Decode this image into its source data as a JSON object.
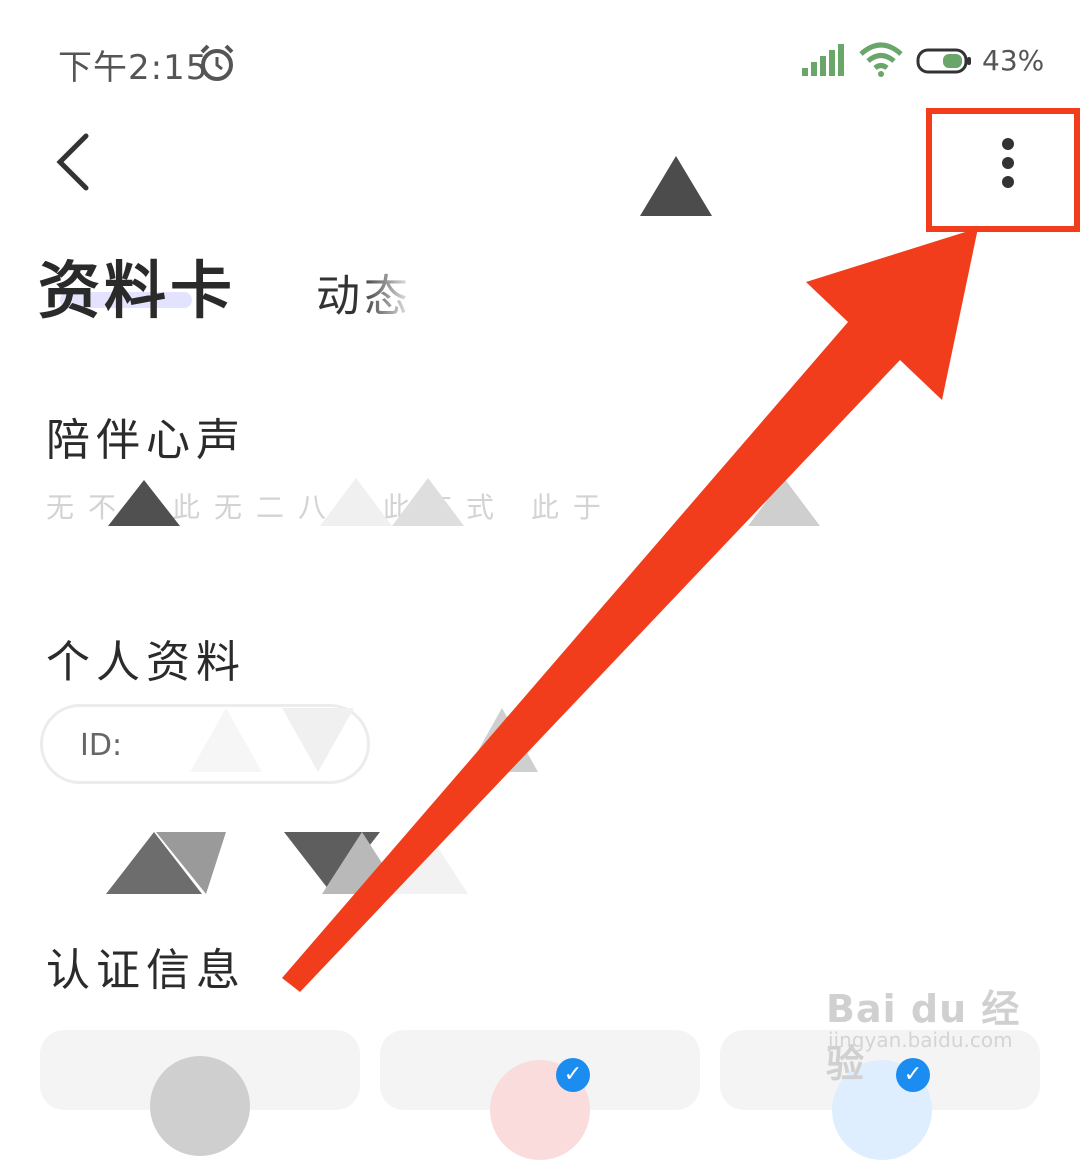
{
  "status_bar": {
    "time": "下午2:15",
    "battery_percent": "43%",
    "battery_level": 0.43
  },
  "tabs": [
    {
      "label": "资料卡",
      "active": true
    },
    {
      "label": "动态",
      "active": false
    }
  ],
  "sections": {
    "voice": "陪伴心声",
    "profile": "个人资料",
    "verification": "认证信息"
  },
  "voice_text": "无不以此无二八以此有式 此于",
  "profile": {
    "id_label": "ID:"
  },
  "annotation": {
    "color": "#f23d1c"
  },
  "watermark": {
    "brand": "Bai du 经验",
    "url": "jingyan.baidu.com"
  },
  "icons": [
    "alarm-icon",
    "signal-icon",
    "wifi-icon",
    "battery-icon",
    "back-arrow-icon",
    "more-vertical-icon",
    "verified-badge-icon"
  ]
}
